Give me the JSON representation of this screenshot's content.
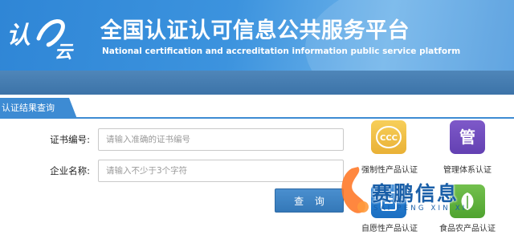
{
  "header": {
    "logo_text": "认证",
    "title_cn": "全国认证认可信息公共服务平台",
    "title_en": "National certification and accreditation information public service platform"
  },
  "tab": {
    "label": "认证结果查询"
  },
  "form": {
    "cert_label": "证书编号:",
    "cert_placeholder": "请输入准确的证书编号",
    "company_label": "企业名称:",
    "company_placeholder": "请输入不少于3个字符",
    "query_button": "查 询"
  },
  "categories": [
    {
      "label": "强制性产品认证",
      "icon": "ccc-icon",
      "color": "#f2c24b"
    },
    {
      "label": "管理体系认证",
      "icon": "management-icon",
      "icon_text": "管",
      "color": "#6f4cbf"
    },
    {
      "label": "自愿性产品认证",
      "icon": "voluntary-icon",
      "color": "#2a7dd0"
    },
    {
      "label": "食品农产品认证",
      "icon": "food-icon",
      "color": "#5cb03a"
    }
  ],
  "watermark": {
    "brand": "赛鹏信息",
    "pinyin": "SAI PENG XIN XI"
  }
}
